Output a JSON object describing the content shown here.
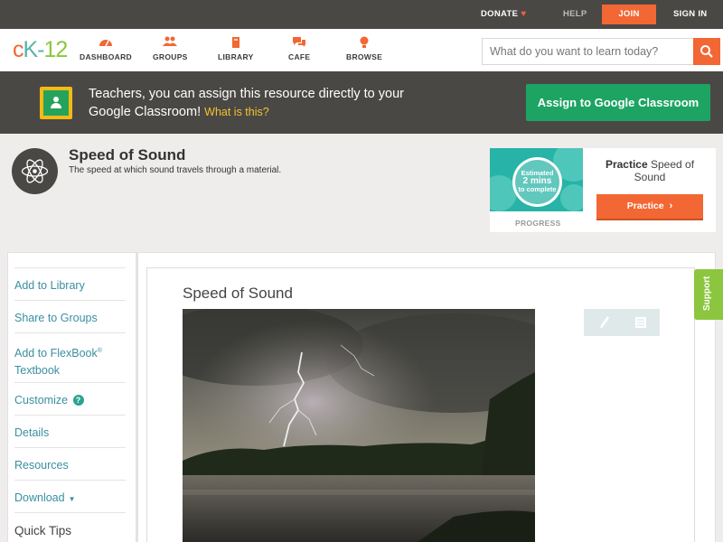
{
  "topbar": {
    "donate": "DONATE",
    "help": "HELP",
    "join": "JOIN",
    "signin": "SIGN IN"
  },
  "logo": {
    "c": "c",
    "k": "K-",
    "n": "12"
  },
  "nav": {
    "items": [
      {
        "label": "DASHBOARD",
        "icon": "dashboard-icon"
      },
      {
        "label": "GROUPS",
        "icon": "groups-icon"
      },
      {
        "label": "LIBRARY",
        "icon": "library-icon"
      },
      {
        "label": "CAFE",
        "icon": "cafe-icon"
      },
      {
        "label": "BROWSE",
        "icon": "browse-icon"
      }
    ]
  },
  "search": {
    "placeholder": "What do you want to learn today?",
    "value": ""
  },
  "banner": {
    "text": "Teachers, you can assign this resource directly to your Google Classroom!",
    "link": "What is this?",
    "button": "Assign to Google Classroom"
  },
  "concept": {
    "title": "Speed of Sound",
    "subtitle": "The speed at which sound travels through a material."
  },
  "practice": {
    "estimate_line1": "Estimated",
    "estimate_line2": "2 mins",
    "estimate_line3": "to complete",
    "progress_label": "PROGRESS",
    "title_bold": "Practice",
    "title_rest": "Speed of Sound",
    "button": "Practice"
  },
  "sidebar": {
    "add_library": "Add to Library",
    "share_groups": "Share to Groups",
    "add_flexbook": "Add to FlexBook",
    "flexbook_reg": "®",
    "flexbook_textbook": "Textbook",
    "customize": "Customize",
    "details": "Details",
    "resources": "Resources",
    "download": "Download",
    "quick_tips": "Quick Tips"
  },
  "lesson": {
    "title": "Speed of Sound"
  },
  "support": "Support",
  "colors": {
    "accent_orange": "#f26733",
    "classroom_green": "#1da462",
    "link_teal": "#3a8fa1",
    "support_green": "#8cc63f",
    "dark_bar": "#4a4845"
  }
}
